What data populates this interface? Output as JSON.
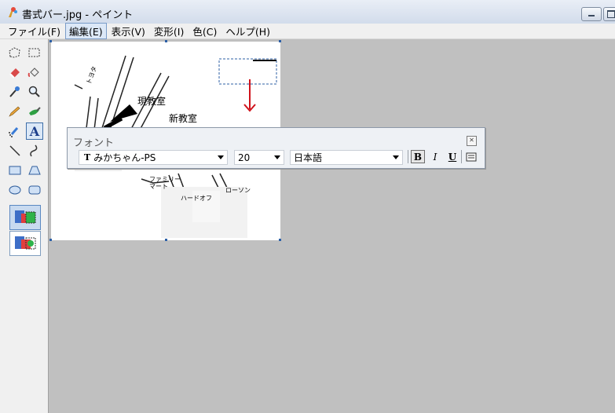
{
  "window": {
    "title": "書式バー.jpg - ペイント"
  },
  "menu": [
    "ファイル(F)",
    "編集(E)",
    "表示(V)",
    "変形(I)",
    "色(C)",
    "ヘルプ(H)"
  ],
  "tools": [
    "free-form-select",
    "rect-select",
    "eraser",
    "fill",
    "color-picker",
    "magnifier",
    "pencil",
    "brush",
    "airbrush",
    "text",
    "line",
    "curve",
    "rectangle",
    "polygon",
    "ellipse",
    "rounded-rectangle"
  ],
  "map": {
    "labels": [
      "現教室",
      "新教室",
      "トヨタ",
      "ファミリーマート",
      "ハードオフ",
      "ローソン"
    ]
  },
  "fontbar": {
    "title": "フォント",
    "font_name": "みかちゃん-PS",
    "font_size": "20",
    "script": "日本語",
    "bold": "B",
    "italic": "I",
    "underline": "U",
    "bold_active": true
  },
  "colors": {
    "accent": "#2c5fa6",
    "arrow": "#d0121b",
    "workspace": "#c0c0c0"
  }
}
